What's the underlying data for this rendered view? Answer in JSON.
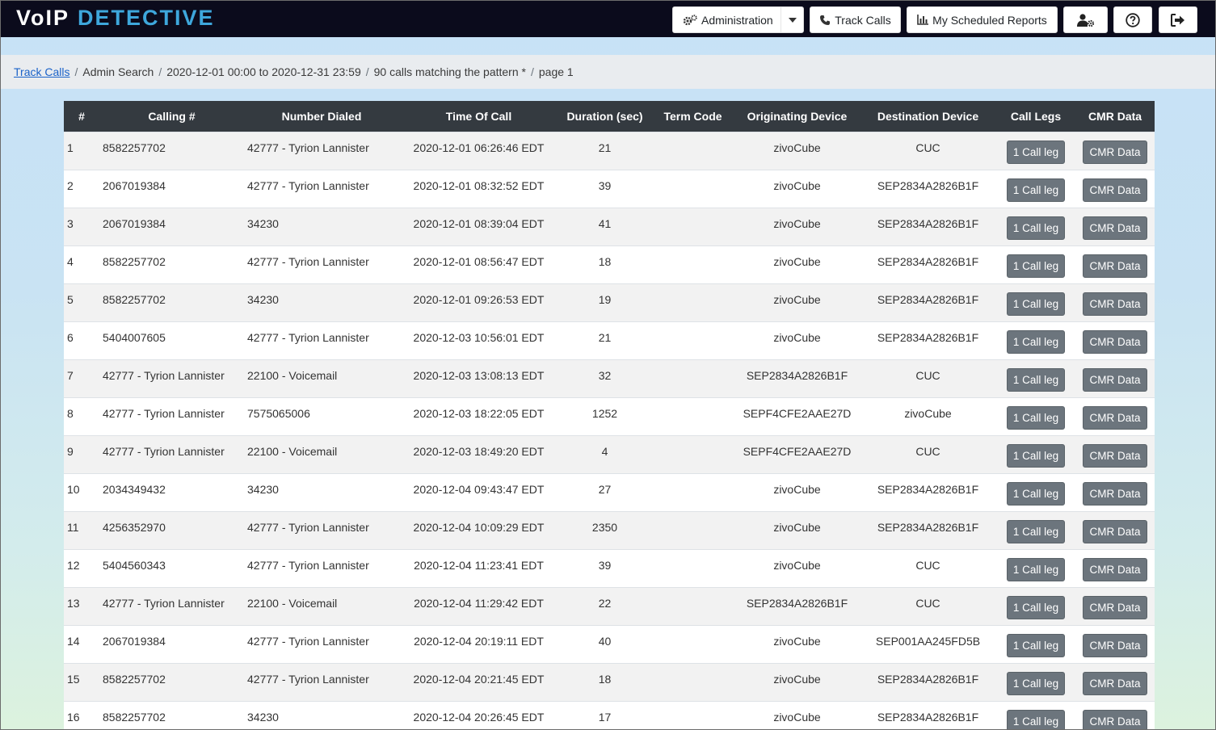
{
  "app": {
    "logo_part1": "VoIP",
    "logo_part2": "DETECTIVE"
  },
  "nav": {
    "administration_label": "Administration",
    "track_calls_label": "Track Calls",
    "scheduled_reports_label": "My Scheduled Reports"
  },
  "breadcrumb": {
    "link": "Track Calls",
    "items": [
      "Admin Search",
      "2020-12-01 00:00 to 2020-12-31 23:59",
      "90 calls matching the pattern *",
      "page 1"
    ]
  },
  "table": {
    "headers": [
      "#",
      "Calling #",
      "Number Dialed",
      "Time Of Call",
      "Duration (sec)",
      "Term Code",
      "Originating Device",
      "Destination Device",
      "Call Legs",
      "CMR Data"
    ],
    "rows": [
      {
        "n": "1",
        "calling": "8582257702",
        "dialed": "42777 - Tyrion Lannister",
        "time": "2020-12-01 06:26:46 EDT",
        "duration": "21",
        "term": "",
        "orig": "zivoCube",
        "dest": "CUC",
        "legs": "1 Call leg",
        "cmr": "CMR Data"
      },
      {
        "n": "2",
        "calling": "2067019384",
        "dialed": "42777 - Tyrion Lannister",
        "time": "2020-12-01 08:32:52 EDT",
        "duration": "39",
        "term": "",
        "orig": "zivoCube",
        "dest": "SEP2834A2826B1F",
        "legs": "1 Call leg",
        "cmr": "CMR Data"
      },
      {
        "n": "3",
        "calling": "2067019384",
        "dialed": "34230",
        "time": "2020-12-01 08:39:04 EDT",
        "duration": "41",
        "term": "",
        "orig": "zivoCube",
        "dest": "SEP2834A2826B1F",
        "legs": "1 Call leg",
        "cmr": "CMR Data"
      },
      {
        "n": "4",
        "calling": "8582257702",
        "dialed": "42777 - Tyrion Lannister",
        "time": "2020-12-01 08:56:47 EDT",
        "duration": "18",
        "term": "",
        "orig": "zivoCube",
        "dest": "SEP2834A2826B1F",
        "legs": "1 Call leg",
        "cmr": "CMR Data"
      },
      {
        "n": "5",
        "calling": "8582257702",
        "dialed": "34230",
        "time": "2020-12-01 09:26:53 EDT",
        "duration": "19",
        "term": "",
        "orig": "zivoCube",
        "dest": "SEP2834A2826B1F",
        "legs": "1 Call leg",
        "cmr": "CMR Data"
      },
      {
        "n": "6",
        "calling": "5404007605",
        "dialed": "42777 - Tyrion Lannister",
        "time": "2020-12-03 10:56:01 EDT",
        "duration": "21",
        "term": "",
        "orig": "zivoCube",
        "dest": "SEP2834A2826B1F",
        "legs": "1 Call leg",
        "cmr": "CMR Data"
      },
      {
        "n": "7",
        "calling": "42777 - Tyrion Lannister",
        "dialed": "22100 - Voicemail",
        "time": "2020-12-03 13:08:13 EDT",
        "duration": "32",
        "term": "",
        "orig": "SEP2834A2826B1F",
        "dest": "CUC",
        "legs": "1 Call leg",
        "cmr": "CMR Data"
      },
      {
        "n": "8",
        "calling": "42777 - Tyrion Lannister",
        "dialed": "7575065006",
        "time": "2020-12-03 18:22:05 EDT",
        "duration": "1252",
        "term": "",
        "orig": "SEPF4CFE2AAE27D",
        "dest": "zivoCube",
        "legs": "1 Call leg",
        "cmr": "CMR Data"
      },
      {
        "n": "9",
        "calling": "42777 - Tyrion Lannister",
        "dialed": "22100 - Voicemail",
        "time": "2020-12-03 18:49:20 EDT",
        "duration": "4",
        "term": "",
        "orig": "SEPF4CFE2AAE27D",
        "dest": "CUC",
        "legs": "1 Call leg",
        "cmr": "CMR Data"
      },
      {
        "n": "10",
        "calling": "2034349432",
        "dialed": "34230",
        "time": "2020-12-04 09:43:47 EDT",
        "duration": "27",
        "term": "",
        "orig": "zivoCube",
        "dest": "SEP2834A2826B1F",
        "legs": "1 Call leg",
        "cmr": "CMR Data"
      },
      {
        "n": "11",
        "calling": "4256352970",
        "dialed": "42777 - Tyrion Lannister",
        "time": "2020-12-04 10:09:29 EDT",
        "duration": "2350",
        "term": "",
        "orig": "zivoCube",
        "dest": "SEP2834A2826B1F",
        "legs": "1 Call leg",
        "cmr": "CMR Data"
      },
      {
        "n": "12",
        "calling": "5404560343",
        "dialed": "42777 - Tyrion Lannister",
        "time": "2020-12-04 11:23:41 EDT",
        "duration": "39",
        "term": "",
        "orig": "zivoCube",
        "dest": "CUC",
        "legs": "1 Call leg",
        "cmr": "CMR Data"
      },
      {
        "n": "13",
        "calling": "42777 - Tyrion Lannister",
        "dialed": "22100 - Voicemail",
        "time": "2020-12-04 11:29:42 EDT",
        "duration": "22",
        "term": "",
        "orig": "SEP2834A2826B1F",
        "dest": "CUC",
        "legs": "1 Call leg",
        "cmr": "CMR Data"
      },
      {
        "n": "14",
        "calling": "2067019384",
        "dialed": "42777 - Tyrion Lannister",
        "time": "2020-12-04 20:19:11 EDT",
        "duration": "40",
        "term": "",
        "orig": "zivoCube",
        "dest": "SEP001AA245FD5B",
        "legs": "1 Call leg",
        "cmr": "CMR Data"
      },
      {
        "n": "15",
        "calling": "8582257702",
        "dialed": "42777 - Tyrion Lannister",
        "time": "2020-12-04 20:21:45 EDT",
        "duration": "18",
        "term": "",
        "orig": "zivoCube",
        "dest": "SEP2834A2826B1F",
        "legs": "1 Call leg",
        "cmr": "CMR Data"
      },
      {
        "n": "16",
        "calling": "8582257702",
        "dialed": "34230",
        "time": "2020-12-04 20:26:45 EDT",
        "duration": "17",
        "term": "",
        "orig": "zivoCube",
        "dest": "SEP2834A2826B1F",
        "legs": "1 Call leg",
        "cmr": "CMR Data"
      }
    ]
  }
}
